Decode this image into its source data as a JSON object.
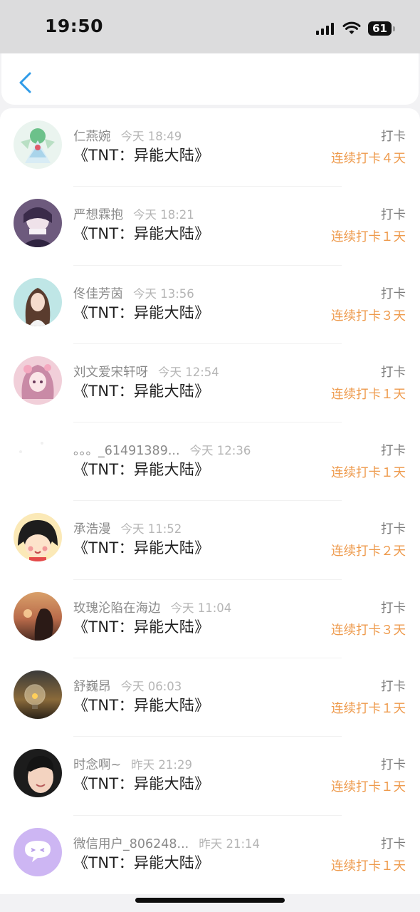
{
  "status": {
    "time": "19:50",
    "battery": "61"
  },
  "nav": {
    "back_icon": "chevron-left-icon",
    "accent": "#2f9be8"
  },
  "colors": {
    "streak": "#ee9a4c"
  },
  "entries": [
    {
      "name": "仁燕婉",
      "time": "今天 18:49",
      "title": "《TNT：异能大陆》",
      "action": "打卡",
      "streak": "连续打卡４天",
      "avatar": "gem-figure"
    },
    {
      "name": "严想霖抱",
      "time": "今天 18:21",
      "title": "《TNT：异能大陆》",
      "action": "打卡",
      "streak": "连续打卡１天",
      "avatar": "purple-anime"
    },
    {
      "name": "佟佳芳茵",
      "time": "今天 13:56",
      "title": "《TNT：异能大陆》",
      "action": "打卡",
      "streak": "连续打卡３天",
      "avatar": "brown-hair-girl"
    },
    {
      "name": "刘文爱宋轩呀",
      "time": "今天 12:54",
      "title": "《TNT：异能大陆》",
      "action": "打卡",
      "streak": "连续打卡１天",
      "avatar": "pink-anime"
    },
    {
      "name": "。。。_61491389...",
      "time": "今天 12:36",
      "title": "《TNT：异能大陆》",
      "action": "打卡",
      "streak": "连续打卡１天",
      "avatar": "blank"
    },
    {
      "name": "承浩漫",
      "time": "今天 11:52",
      "title": "《TNT：异能大陆》",
      "action": "打卡",
      "streak": "连续打卡２天",
      "avatar": "cartoon-girl"
    },
    {
      "name": "玫瑰沦陷在海边",
      "time": "今天 11:04",
      "title": "《TNT：异能大陆》",
      "action": "打卡",
      "streak": "连续打卡３天",
      "avatar": "sunset-silhouette"
    },
    {
      "name": "舒巍昂",
      "time": "今天 06:03",
      "title": "《TNT：异能大陆》",
      "action": "打卡",
      "streak": "连续打卡１天",
      "avatar": "lightbulb"
    },
    {
      "name": "时念啊~",
      "time": "昨天 21:29",
      "title": "《TNT：异能大陆》",
      "action": "打卡",
      "streak": "连续打卡１天",
      "avatar": "young-man"
    },
    {
      "name": "微信用户_806248...",
      "time": "昨天 21:14",
      "title": "《TNT：异能大陆》",
      "action": "打卡",
      "streak": "连续打卡１天",
      "avatar": "chat-bubble"
    }
  ]
}
